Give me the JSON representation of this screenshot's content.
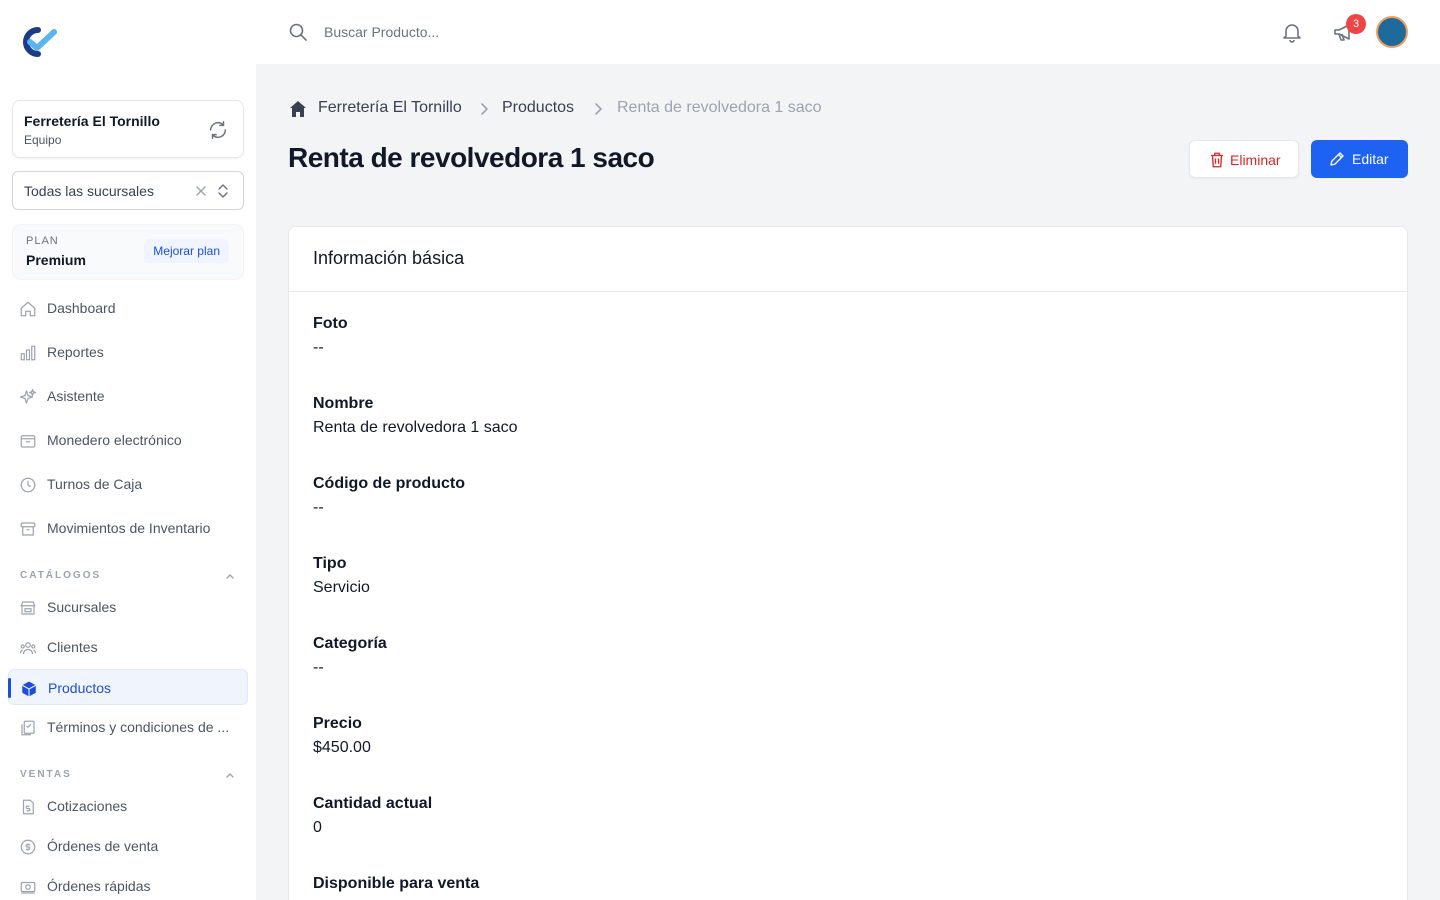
{
  "colors": {
    "accent": "#1d62f0",
    "danger": "#dc2626",
    "badge": "#ef4444"
  },
  "sidebar": {
    "team": {
      "name": "Ferretería El Tornillo",
      "subtitle": "Equipo"
    },
    "branch_select": {
      "value": "Todas las sucursales"
    },
    "plan": {
      "label": "PLAN",
      "name": "Premium",
      "upgrade_label": "Mejorar plan"
    },
    "items": [
      {
        "label": "Dashboard",
        "icon": "home-icon"
      },
      {
        "label": "Reportes",
        "icon": "bar-chart-icon"
      },
      {
        "label": "Asistente",
        "icon": "sparkles-icon"
      },
      {
        "label": "Monedero electrónico",
        "icon": "wallet-icon"
      },
      {
        "label": "Turnos de Caja",
        "icon": "clock-icon"
      },
      {
        "label": "Movimientos de Inventario",
        "icon": "archive-icon"
      }
    ],
    "sections": [
      {
        "title": "CATÁLOGOS",
        "items": [
          {
            "label": "Sucursales",
            "icon": "store-icon"
          },
          {
            "label": "Clientes",
            "icon": "users-icon"
          },
          {
            "label": "Productos",
            "icon": "cube-icon",
            "active": true
          },
          {
            "label": "Términos y condiciones de ...",
            "icon": "documents-icon"
          }
        ]
      },
      {
        "title": "VENTAS",
        "items": [
          {
            "label": "Cotizaciones",
            "icon": "document-dollar-icon"
          },
          {
            "label": "Órdenes de venta",
            "icon": "dollar-circle-icon"
          },
          {
            "label": "Órdenes rápidas",
            "icon": "cash-icon"
          }
        ]
      }
    ]
  },
  "topbar": {
    "search_placeholder": "Buscar Producto...",
    "announcements_count": "3"
  },
  "breadcrumb": [
    "Ferretería El Tornillo",
    "Productos",
    "Renta de revolvedora 1 saco"
  ],
  "page": {
    "title": "Renta de revolvedora 1 saco",
    "delete_label": "Eliminar",
    "edit_label": "Editar"
  },
  "card": {
    "title": "Información básica",
    "fields": [
      {
        "label": "Foto",
        "value": "--"
      },
      {
        "label": "Nombre",
        "value": "Renta de revolvedora 1 saco"
      },
      {
        "label": "Código de producto",
        "value": "--"
      },
      {
        "label": "Tipo",
        "value": "Servicio"
      },
      {
        "label": "Categoría",
        "value": "--"
      },
      {
        "label": "Precio",
        "value": "$450.00"
      },
      {
        "label": "Cantidad actual",
        "value": "0"
      },
      {
        "label": "Disponible para venta",
        "value": ""
      }
    ]
  }
}
